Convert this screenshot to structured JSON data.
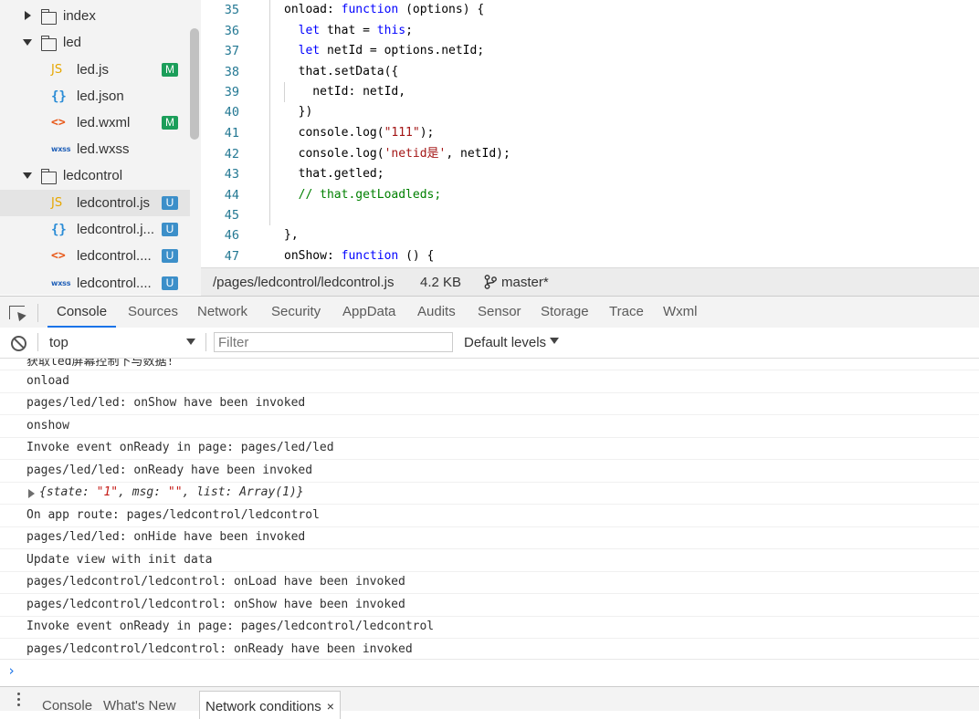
{
  "file_tree": {
    "items": [
      {
        "type": "folder",
        "expanded": false,
        "label": "index"
      },
      {
        "type": "folder",
        "expanded": true,
        "label": "led"
      },
      {
        "type": "file",
        "icon": "js-file-icon",
        "icon_text": "JS",
        "label": "led.js",
        "badge": "M"
      },
      {
        "type": "file",
        "icon": "json-file-icon",
        "icon_text": "{}",
        "label": "led.json",
        "badge": ""
      },
      {
        "type": "file",
        "icon": "wxml-file-icon",
        "icon_text": "<>",
        "label": "led.wxml",
        "badge": "M"
      },
      {
        "type": "file",
        "icon": "wxss-file-icon",
        "icon_text": "wxss",
        "label": "led.wxss",
        "badge": ""
      },
      {
        "type": "folder",
        "expanded": true,
        "label": "ledcontrol"
      },
      {
        "type": "file",
        "icon": "js-file-icon",
        "icon_text": "JS",
        "label": "ledcontrol.js",
        "badge": "U",
        "selected": true
      },
      {
        "type": "file",
        "icon": "json-file-icon",
        "icon_text": "{}",
        "label": "ledcontrol.j...",
        "badge": "U"
      },
      {
        "type": "file",
        "icon": "wxml-file-icon",
        "icon_text": "<>",
        "label": "ledcontrol....",
        "badge": "U"
      },
      {
        "type": "file",
        "icon": "wxss-file-icon",
        "icon_text": "wxss",
        "label": "ledcontrol....",
        "badge": "U"
      }
    ]
  },
  "editor": {
    "lines": [
      {
        "n": "35",
        "text": "onload: function (options) {"
      },
      {
        "n": "36",
        "text": "  let that = this;"
      },
      {
        "n": "37",
        "text": "  let netId = options.netId;"
      },
      {
        "n": "38",
        "text": "  that.setData({"
      },
      {
        "n": "39",
        "text": "    netId: netId,"
      },
      {
        "n": "40",
        "text": "  })"
      },
      {
        "n": "41",
        "text": "  console.log(\"111\");"
      },
      {
        "n": "42",
        "text": "  console.log('netid是', netId);"
      },
      {
        "n": "43",
        "text": "  that.getled;"
      },
      {
        "n": "44",
        "text": "  // that.getLoadleds;"
      },
      {
        "n": "45",
        "text": ""
      },
      {
        "n": "46",
        "text": "},"
      },
      {
        "n": "47",
        "text": "onShow: function () {"
      }
    ]
  },
  "status_bar": {
    "path": "/pages/ledcontrol/ledcontrol.js",
    "size": "4.2 KB",
    "branch": "master*"
  },
  "devtools_tabs": [
    "Console",
    "Sources",
    "Network",
    "Security",
    "AppData",
    "Audits",
    "Sensor",
    "Storage",
    "Trace",
    "Wxml"
  ],
  "console_toolbar": {
    "context": "top",
    "filter_placeholder": "Filter",
    "levels": "Default levels"
  },
  "console_logs": [
    {
      "text": "获取led屏幕控制下与数据!"
    },
    {
      "text": "onload"
    },
    {
      "text": "pages/led/led: onShow have been invoked"
    },
    {
      "text": "onshow"
    },
    {
      "text": "Invoke event onReady in page: pages/led/led"
    },
    {
      "text": "pages/led/led: onReady have been invoked"
    },
    {
      "text": "{state: \"1\", msg: \"\", list: Array(1)}",
      "object": true
    },
    {
      "text": "On app route: pages/ledcontrol/ledcontrol"
    },
    {
      "text": "pages/led/led: onHide have been invoked"
    },
    {
      "text": "Update view with init data"
    },
    {
      "text": "pages/ledcontrol/ledcontrol: onLoad have been invoked"
    },
    {
      "text": "pages/ledcontrol/ledcontrol: onShow have been invoked"
    },
    {
      "text": "Invoke event onReady in page: pages/ledcontrol/ledcontrol"
    },
    {
      "text": "pages/ledcontrol/ledcontrol: onReady have been invoked"
    }
  ],
  "console_prompt": "›",
  "drawer": {
    "tabs": [
      "Console",
      "What's New"
    ],
    "active_tab": "Network conditions",
    "close_glyph": "×"
  }
}
